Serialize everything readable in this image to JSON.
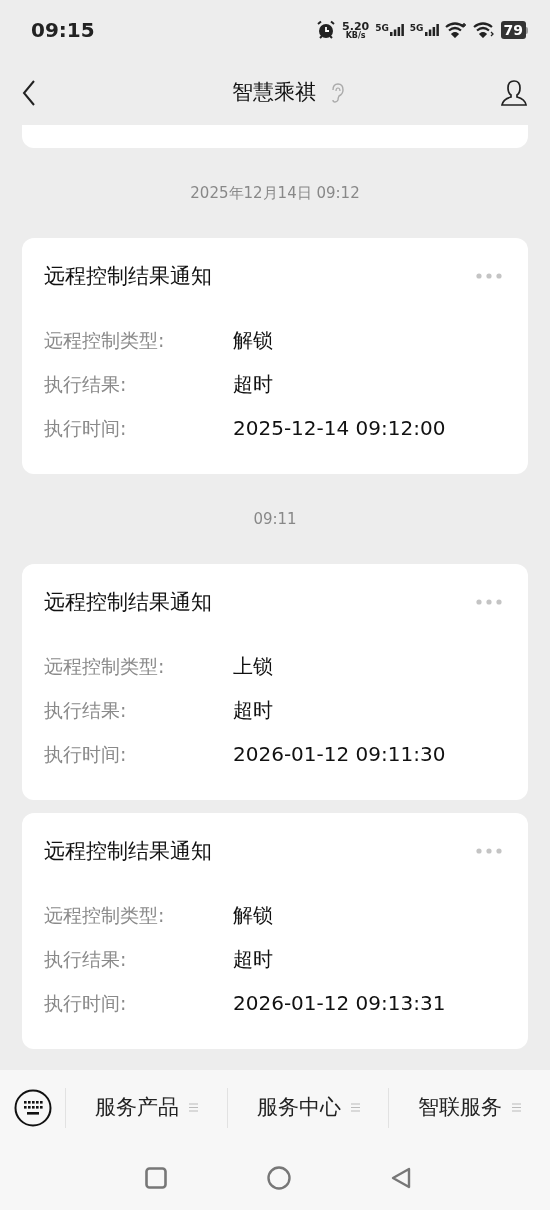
{
  "status_bar": {
    "time": "09:15",
    "speed_value": "5.20",
    "speed_unit": "KB/s",
    "networks": [
      "5G",
      "5G"
    ],
    "battery": "79"
  },
  "header": {
    "title": "智慧乘祺"
  },
  "groups": [
    {
      "timestamp": "2025年12月14日 09:12",
      "cards": [
        {
          "title": "远程控制结果通知",
          "rows": [
            {
              "label": "远程控制类型:",
              "value": "解锁"
            },
            {
              "label": "执行结果:",
              "value": "超时"
            },
            {
              "label": "执行时间:",
              "value": "2025-12-14 09:12:00"
            }
          ]
        }
      ]
    },
    {
      "timestamp": "09:11",
      "cards": [
        {
          "title": "远程控制结果通知",
          "rows": [
            {
              "label": "远程控制类型:",
              "value": "上锁"
            },
            {
              "label": "执行结果:",
              "value": "超时"
            },
            {
              "label": "执行时间:",
              "value": "2026-01-12 09:11:30"
            }
          ]
        },
        {
          "title": "远程控制结果通知",
          "rows": [
            {
              "label": "远程控制类型:",
              "value": "解锁"
            },
            {
              "label": "执行结果:",
              "value": "超时"
            },
            {
              "label": "执行时间:",
              "value": "2026-01-12 09:13:31"
            }
          ]
        }
      ]
    }
  ],
  "bottom_menu": [
    {
      "label": "服务产品"
    },
    {
      "label": "服务中心"
    },
    {
      "label": "智联服务"
    }
  ]
}
